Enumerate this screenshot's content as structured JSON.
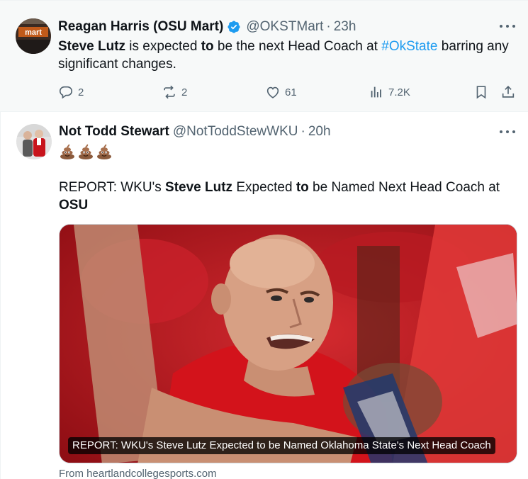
{
  "tweets": [
    {
      "author_name": "Reagan Harris (OSU Mart)",
      "verified": true,
      "handle": "@OKSTMart",
      "separator": "·",
      "time": "23h",
      "avatar_text": "mart",
      "text": {
        "part1_bold": "Steve Lutz",
        "part2": " is expected ",
        "part3_bold": "to",
        "part4": " be the next Head Coach at ",
        "hashtag": "#OkState",
        "part5": " barring any significant changes."
      },
      "actions": {
        "replies": "2",
        "reposts": "2",
        "likes": "61",
        "views": "7.2K"
      }
    },
    {
      "author_name": "Not Todd Stewart",
      "handle": "@NotToddStewWKU",
      "separator": "·",
      "time": "20h",
      "emoji": "💩💩💩",
      "text": {
        "part1": "REPORT: WKU's ",
        "part2_bold": "Steve Lutz",
        "part3": " Expected ",
        "part4_bold": "to",
        "part5": " be Named Next Head Coach at ",
        "part6_bold": "OSU"
      },
      "card": {
        "caption": "REPORT: WKU's Steve Lutz Expected to be Named Oklahoma State's Next Head Coach",
        "source": "From heartlandcollegesports.com"
      }
    }
  ],
  "colors": {
    "link": "#1d9bf0",
    "secondary": "#536471",
    "verified": "#1d9bf0"
  }
}
